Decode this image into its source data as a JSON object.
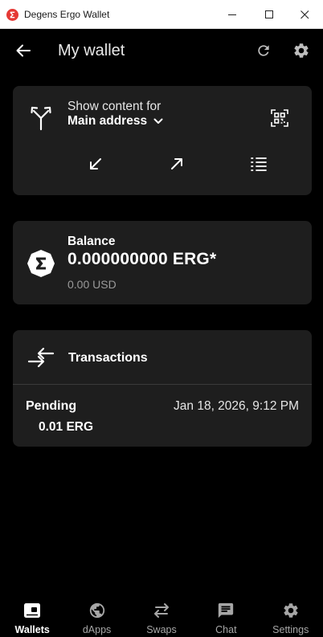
{
  "window": {
    "title": "Degens Ergo Wallet"
  },
  "appbar": {
    "title": "My wallet"
  },
  "address_card": {
    "show_label": "Show content for",
    "address_selected": "Main address"
  },
  "balance_card": {
    "label": "Balance",
    "amount": "0.000000000 ERG*",
    "fiat": "0.00 USD"
  },
  "transactions_card": {
    "title": "Transactions",
    "items": [
      {
        "status": "Pending",
        "date": "Jan 18, 2026, 9:12 PM",
        "amount": "0.01 ERG"
      }
    ]
  },
  "bottom_nav": {
    "items": [
      {
        "label": "Wallets",
        "icon": "wallet-icon",
        "active": true
      },
      {
        "label": "dApps",
        "icon": "globe-icon",
        "active": false
      },
      {
        "label": "Swaps",
        "icon": "swap-arrows-icon",
        "active": false
      },
      {
        "label": "Chat",
        "icon": "chat-bubble-icon",
        "active": false
      },
      {
        "label": "Settings",
        "icon": "gear-icon",
        "active": false
      }
    ]
  },
  "colors": {
    "background": "#000000",
    "card": "#1e1e1e",
    "accent_red": "#e53935",
    "muted_text": "#9a9a9a"
  }
}
